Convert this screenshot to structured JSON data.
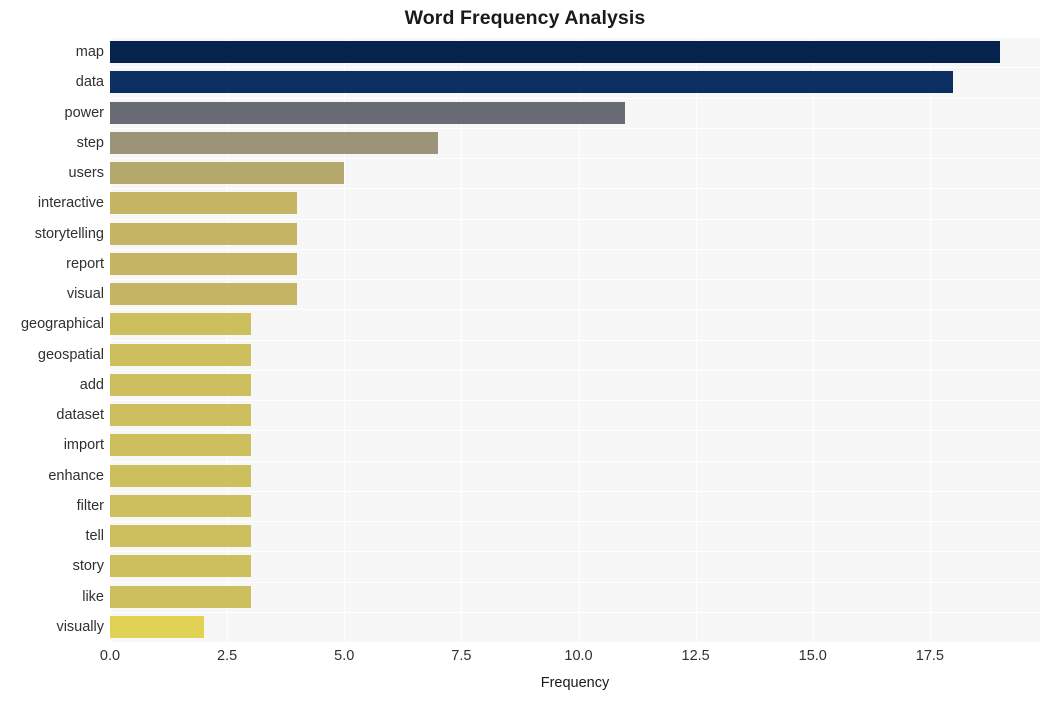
{
  "chart_data": {
    "type": "bar",
    "orientation": "horizontal",
    "title": "Word Frequency Analysis",
    "xlabel": "Frequency",
    "ylabel": "",
    "categories": [
      "map",
      "data",
      "power",
      "step",
      "users",
      "interactive",
      "storytelling",
      "report",
      "visual",
      "geographical",
      "geospatial",
      "add",
      "dataset",
      "import",
      "enhance",
      "filter",
      "tell",
      "story",
      "like",
      "visually"
    ],
    "values": [
      19,
      18,
      11,
      7,
      5,
      4,
      4,
      4,
      4,
      3,
      3,
      3,
      3,
      3,
      3,
      3,
      3,
      3,
      3,
      2
    ],
    "bar_colors": [
      "#05234d",
      "#0a2f60",
      "#696b74",
      "#9b9479",
      "#b5a86c",
      "#c4b464",
      "#c4b464",
      "#c4b464",
      "#c4b464",
      "#cdbf5e",
      "#cdbf5e",
      "#cdbf5e",
      "#cdbf5e",
      "#cdbf5e",
      "#cdbf5e",
      "#cdbf5e",
      "#cdbf5e",
      "#cdbf5e",
      "#cdbf5e",
      "#e2d254"
    ],
    "xlim": [
      0,
      19.85
    ],
    "ylim_order": "descending",
    "xticks": [
      0.0,
      2.5,
      5.0,
      7.5,
      10.0,
      12.5,
      15.0,
      17.5
    ],
    "xticklabels": [
      "0.0",
      "2.5",
      "5.0",
      "7.5",
      "10.0",
      "12.5",
      "15.0",
      "17.5"
    ],
    "grid": {
      "vertical": true,
      "horizontal": true,
      "color": "#ffffff"
    },
    "legend": null,
    "plot_background": "#f7f7f7",
    "figure_background": "#ffffff"
  }
}
